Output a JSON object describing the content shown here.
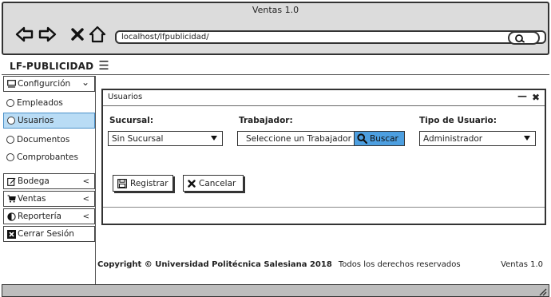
{
  "window": {
    "title": "Ventas 1.0"
  },
  "browser": {
    "url": "localhost/lfpublicidad/",
    "icons": {
      "back": "arrow-left-icon",
      "forward": "arrow-right-icon",
      "close": "close-icon",
      "home": "home-icon",
      "search": "search-icon"
    }
  },
  "header": {
    "brand": "LF-PUBLICIDAD",
    "menu_icon": "hamburger-icon"
  },
  "sidebar": {
    "groups": [
      {
        "label": "Configurción",
        "icon": "monitor-icon",
        "chevron": "⌄",
        "expanded": true
      },
      {
        "label": "Bodega",
        "icon": "edit-icon",
        "chevron": "<"
      },
      {
        "label": "Ventas",
        "icon": "cart-icon",
        "chevron": "<"
      },
      {
        "label": "Reportería",
        "icon": "pie-chart-icon",
        "chevron": "<"
      },
      {
        "label": "Cerrar Sesión",
        "icon": "logout-x-icon"
      }
    ],
    "subitems": [
      {
        "label": "Empleados",
        "active": false
      },
      {
        "label": "Usuarios",
        "active": true
      },
      {
        "label": "Documentos",
        "active": false
      },
      {
        "label": "Comprobantes",
        "active": false
      }
    ],
    "active_color": "#b9dcf5"
  },
  "panel": {
    "title": "Usuarios",
    "minimize": "—",
    "close": "✖",
    "fields": {
      "sucursal_label": "Sucursal:",
      "sucursal_value": "Sin Sucursal",
      "trabajador_label": "Trabajador:",
      "trabajador_placeholder": "Seleccione un Trabajador",
      "search_button": "Buscar",
      "tipo_label": "Tipo de Usuario:",
      "tipo_value": "Administrador"
    },
    "buttons": {
      "register": "Registrar",
      "cancel": "Cancelar"
    },
    "accent": "#4d9fe0"
  },
  "footer": {
    "copyright": "Copyright © Universidad Politécnica Salesiana 2018",
    "rights": "Todos los derechos reservados",
    "version": "Ventas 1.0"
  }
}
